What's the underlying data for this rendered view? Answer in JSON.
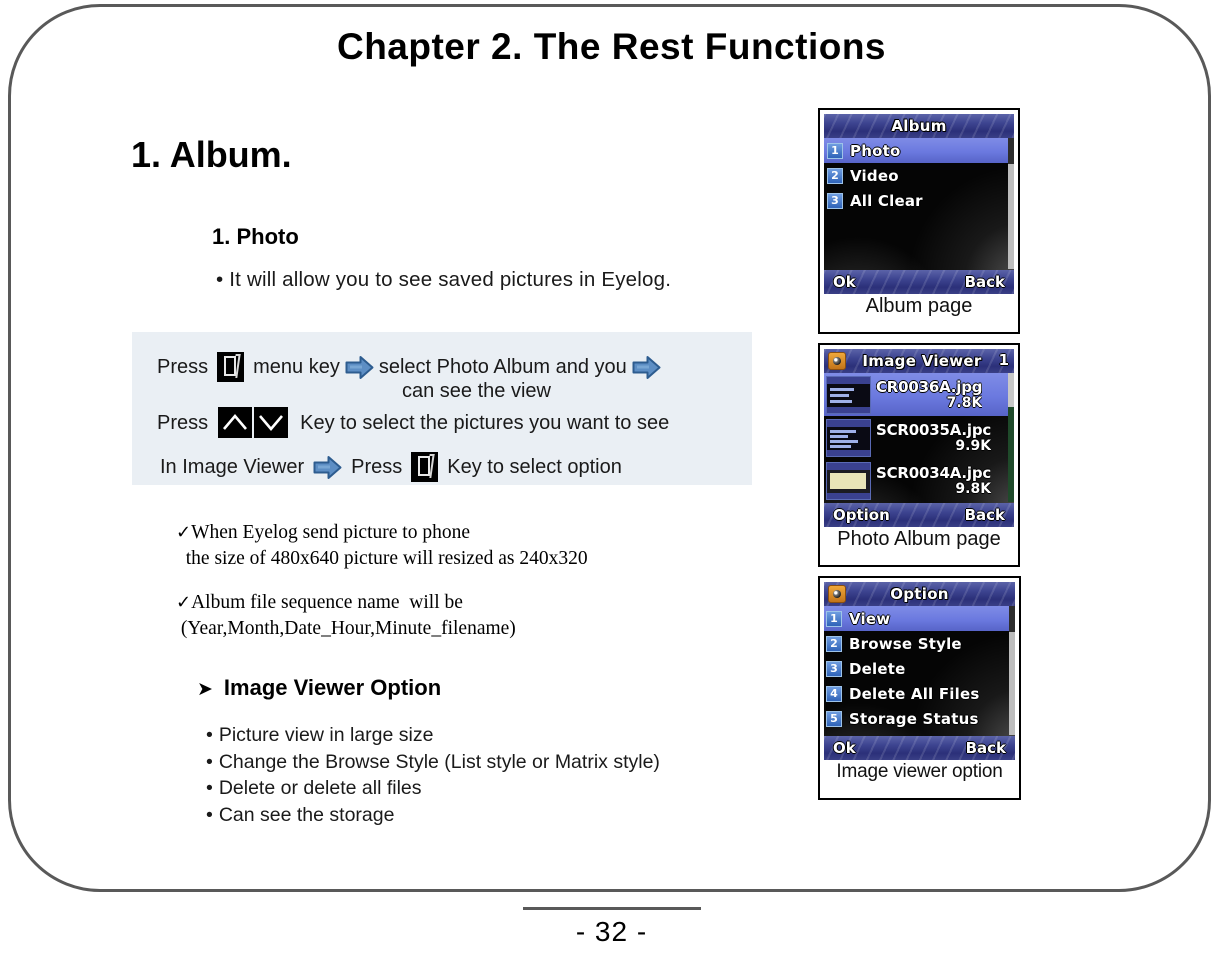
{
  "slide": {
    "title": "Chapter 2. The Rest Functions",
    "page_number": "- 32 -"
  },
  "content": {
    "section_heading": "1. Album.",
    "subsection_heading": "1. Photo",
    "subsection_bullet": "• It will allow you to see saved pictures in Eyelog."
  },
  "instructions": {
    "row1": {
      "press_label": "Press",
      "key_icon": "menu-key-icon",
      "after_key": "menu key",
      "arrow1": "right-arrow-icon",
      "text_after_arrow": "select Photo Album and you",
      "arrow2": "right-arrow-icon",
      "wrapped_text": "can see the view"
    },
    "row2": {
      "press_label": "Press",
      "up_key": "up-arrow-key-icon",
      "down_key": "down-arrow-key-icon",
      "text": "Key to select the pictures you want to see"
    },
    "row3": {
      "lead": "In Image Viewer",
      "arrow": "right-arrow-icon",
      "press_label": "Press",
      "key_icon": "menu-key-icon",
      "text": "Key to select option"
    }
  },
  "notes": [
    {
      "mark": "✓",
      "line1": "When Eyelog send picture to phone",
      "line2": "  the size of 480x640 picture will resized as 240x320"
    },
    {
      "mark": "✓",
      "line1": "Album file sequence name  will be",
      "line2": " (Year,Month,Date_Hour,Minute_filename)"
    }
  ],
  "image_viewer_option": {
    "bullet": "➤",
    "heading": "Image Viewer Option",
    "items": [
      "Picture view in large size",
      "Change the Browse Style (List style or Matrix style)",
      "Delete or delete all files",
      "Can see the storage"
    ],
    "bullet_char": "•"
  },
  "phone_screens": [
    {
      "id": "album",
      "caption": "Album page",
      "titlebar": {
        "text": "Album",
        "icon": null,
        "index": null
      },
      "menu_items": [
        {
          "num": "1",
          "label": "Photo",
          "selected": true
        },
        {
          "num": "2",
          "label": "Video",
          "selected": false
        },
        {
          "num": "3",
          "label": "All Clear",
          "selected": false
        }
      ],
      "softkeys": {
        "left": "Ok",
        "right": "Back"
      }
    },
    {
      "id": "photo-album",
      "caption": "Photo Album page",
      "titlebar": {
        "text": "Image Viewer",
        "icon": "camera-icon",
        "index": "1"
      },
      "files": [
        {
          "name": "CR0036A.jpg",
          "size": "7.8K",
          "selected": true
        },
        {
          "name": "SCR0035A.jpc",
          "size": "9.9K",
          "selected": false
        },
        {
          "name": "SCR0034A.jpc",
          "size": "9.8K",
          "selected": false
        }
      ],
      "softkeys": {
        "left": "Option",
        "right": "Back"
      }
    },
    {
      "id": "image-viewer-option",
      "caption": "Image viewer option",
      "titlebar": {
        "text": "Option",
        "icon": "camera-icon",
        "index": null
      },
      "menu_items": [
        {
          "num": "1",
          "label": "View",
          "selected": true
        },
        {
          "num": "2",
          "label": "Browse Style",
          "selected": false
        },
        {
          "num": "3",
          "label": "Delete",
          "selected": false
        },
        {
          "num": "4",
          "label": "Delete All Files",
          "selected": false
        },
        {
          "num": "5",
          "label": "Storage Status",
          "selected": false
        }
      ],
      "softkeys": {
        "left": "Ok",
        "right": "Back"
      }
    }
  ],
  "colors": {
    "frame_border": "#595959",
    "instruction_bg": "#eaeff4",
    "arrow_blue": "#4a7ebb",
    "arrow_blue_dark": "#2e5b8e",
    "phone_titlebar": "#2b3079",
    "phone_selection": "#6b79df"
  }
}
